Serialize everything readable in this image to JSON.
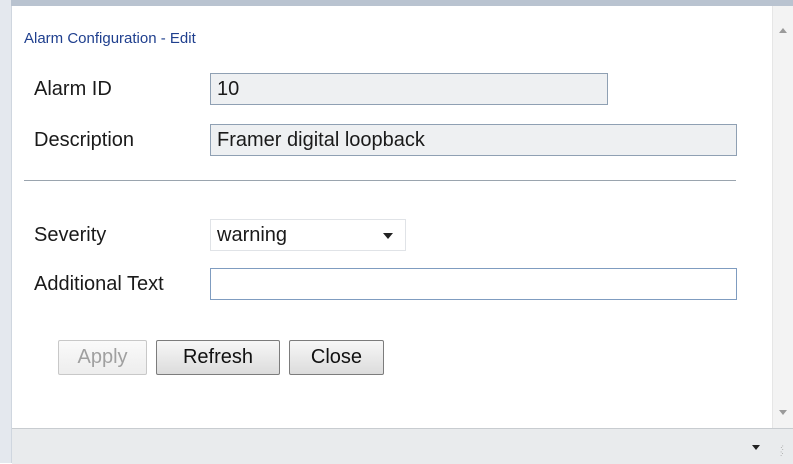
{
  "panel": {
    "title": "Alarm Configuration - Edit"
  },
  "form": {
    "alarm_id": {
      "label": "Alarm ID",
      "value": "10"
    },
    "description": {
      "label": "Description",
      "value": "Framer digital loopback"
    },
    "severity": {
      "label": "Severity",
      "selected": "warning"
    },
    "additional_text": {
      "label": "Additional Text",
      "value": ""
    }
  },
  "buttons": {
    "apply": "Apply",
    "refresh": "Refresh",
    "close": "Close"
  },
  "icons": {
    "scroll_up": "chevron-up-icon",
    "scroll_down": "chevron-down-icon",
    "status_menu": "caret-down-icon",
    "resize": "resize-grip-icon"
  },
  "colors": {
    "title": "#1f3f8e",
    "readonly_field_bg": "#eef0f2",
    "field_border": "#8fa0b3"
  }
}
